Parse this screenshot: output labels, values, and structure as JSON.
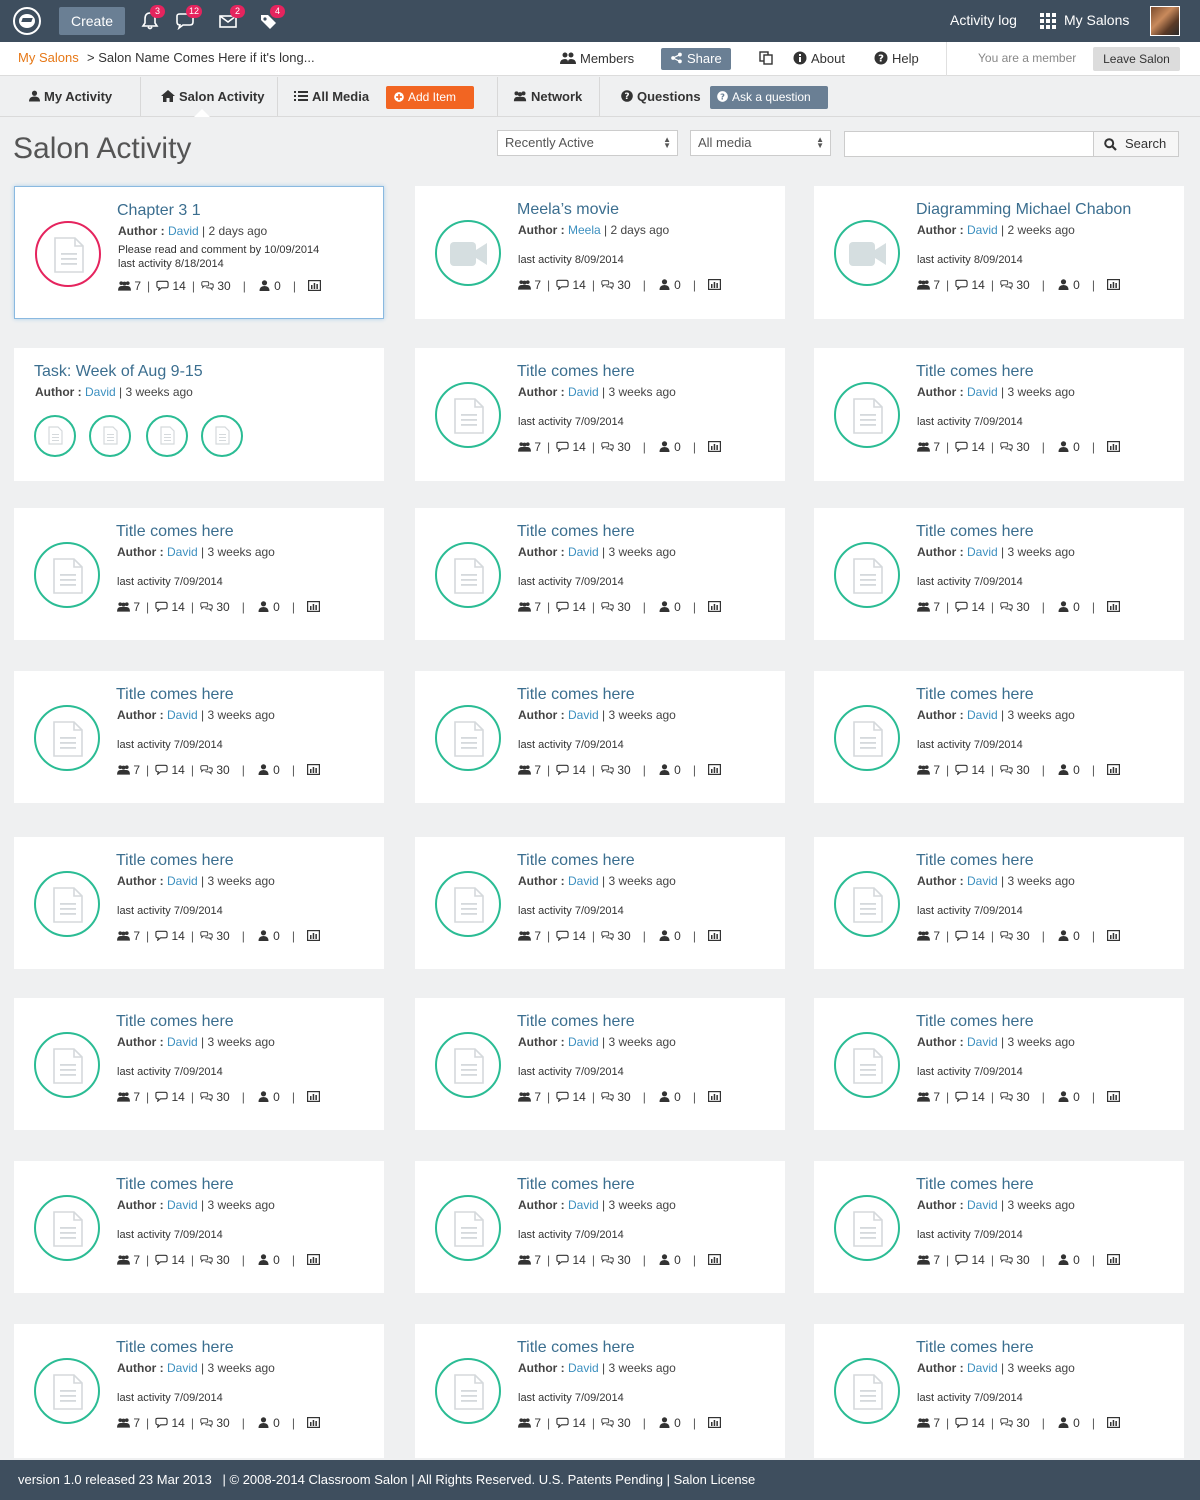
{
  "topbar": {
    "create_label": "Create",
    "badges": {
      "notifications": "3",
      "comments": "12",
      "messages": "2",
      "tags": "4"
    },
    "activity_log": "Activity log",
    "my_salons": "My Salons"
  },
  "subbar": {
    "crumb_root": "My Salons",
    "crumb_current": "> Salon Name Comes Here if it's long...",
    "members": "Members",
    "share": "Share",
    "about": "About",
    "help": "Help",
    "member_status": "You are a member",
    "leave": "Leave Salon"
  },
  "tabs": {
    "my_activity": "My Activity",
    "salon_activity": "Salon Activity",
    "all_media": "All Media",
    "add_item": "Add Item",
    "network": "Network",
    "questions": "Questions",
    "ask_question": "Ask a question"
  },
  "page": {
    "title": "Salon Activity",
    "sort_select": "Recently Active",
    "media_select": "All media",
    "search_button": "Search",
    "search_value": ""
  },
  "colors": {
    "accent_teal": "#2bbc94",
    "accent_pink": "#e5245e",
    "link": "#3b6e8f",
    "orange": "#f26522",
    "nav_bg": "#3e4e5e"
  },
  "cards": [
    {
      "title": "Chapter 3 1",
      "author_label": "Author :",
      "author": "David",
      "when": "| 2 days ago",
      "note": "Please read and comment by 10/09/2014",
      "last": "last activity 8/18/2014",
      "icon": "document-icon",
      "style": "pink",
      "stats": [
        "7",
        "14",
        "30",
        "0"
      ]
    },
    {
      "title": "Meela’s movie",
      "author_label": "Author :",
      "author": "Meela",
      "when": "| 2 days ago",
      "note": "",
      "last": "last activity 8/09/2014",
      "icon": "video-icon",
      "style": "video",
      "stats": [
        "7",
        "14",
        "30",
        "0"
      ]
    },
    {
      "title": "Diagramming Michael Chabon",
      "author_label": "Author :",
      "author": "David",
      "when": "| 2 weeks ago",
      "note": "",
      "last": "last activity 8/09/2014",
      "icon": "video-icon",
      "style": "video",
      "stats": [
        "7",
        "14",
        "30",
        "0"
      ]
    },
    {
      "title": "Task: Week of Aug 9-15",
      "author_label": "Author :",
      "author": "David",
      "when": "| 3 weeks ago",
      "task": true
    },
    {
      "title": "Title comes here",
      "author_label": "Author :",
      "author": "David",
      "when": "| 3 weeks ago",
      "note": "",
      "last": "last activity 7/09/2014",
      "icon": "document-icon",
      "style": "doc",
      "stats": [
        "7",
        "14",
        "30",
        "0"
      ]
    },
    {
      "title": "Title comes here",
      "author_label": "Author :",
      "author": "David",
      "when": "| 3 weeks ago",
      "note": "",
      "last": "last activity 7/09/2014",
      "icon": "document-icon",
      "style": "doc",
      "stats": [
        "7",
        "14",
        "30",
        "0"
      ]
    },
    {
      "title": "Title comes here",
      "author_label": "Author :",
      "author": "David",
      "when": "| 3 weeks ago",
      "note": "",
      "last": "last activity 7/09/2014",
      "icon": "document-icon",
      "style": "doc",
      "stats": [
        "7",
        "14",
        "30",
        "0"
      ]
    },
    {
      "title": "Title comes here",
      "author_label": "Author :",
      "author": "David",
      "when": "| 3 weeks ago",
      "note": "",
      "last": "last activity 7/09/2014",
      "icon": "document-icon",
      "style": "doc",
      "stats": [
        "7",
        "14",
        "30",
        "0"
      ]
    },
    {
      "title": "Title comes here",
      "author_label": "Author :",
      "author": "David",
      "when": "| 3 weeks ago",
      "note": "",
      "last": "last activity 7/09/2014",
      "icon": "document-icon",
      "style": "doc",
      "stats": [
        "7",
        "14",
        "30",
        "0"
      ]
    },
    {
      "title": "Title comes here",
      "author_label": "Author :",
      "author": "David",
      "when": "| 3 weeks ago",
      "note": "",
      "last": "last activity 7/09/2014",
      "icon": "document-icon",
      "style": "doc",
      "stats": [
        "7",
        "14",
        "30",
        "0"
      ]
    },
    {
      "title": "Title comes here",
      "author_label": "Author :",
      "author": "David",
      "when": "| 3 weeks ago",
      "note": "",
      "last": "last activity 7/09/2014",
      "icon": "document-icon",
      "style": "doc",
      "stats": [
        "7",
        "14",
        "30",
        "0"
      ]
    },
    {
      "title": "Title comes here",
      "author_label": "Author :",
      "author": "David",
      "when": "| 3 weeks ago",
      "note": "",
      "last": "last activity 7/09/2014",
      "icon": "document-icon",
      "style": "doc",
      "stats": [
        "7",
        "14",
        "30",
        "0"
      ]
    },
    {
      "title": "Title comes here",
      "author_label": "Author :",
      "author": "David",
      "when": "| 3 weeks ago",
      "note": "",
      "last": "last activity 7/09/2014",
      "icon": "document-icon",
      "style": "doc",
      "stats": [
        "7",
        "14",
        "30",
        "0"
      ]
    },
    {
      "title": "Title comes here",
      "author_label": "Author :",
      "author": "David",
      "when": "| 3 weeks ago",
      "note": "",
      "last": "last activity 7/09/2014",
      "icon": "document-icon",
      "style": "doc",
      "stats": [
        "7",
        "14",
        "30",
        "0"
      ]
    },
    {
      "title": "Title comes here",
      "author_label": "Author :",
      "author": "David",
      "when": "| 3 weeks ago",
      "note": "",
      "last": "last activity 7/09/2014",
      "icon": "document-icon",
      "style": "doc",
      "stats": [
        "7",
        "14",
        "30",
        "0"
      ]
    },
    {
      "title": "Title comes here",
      "author_label": "Author :",
      "author": "David",
      "when": "| 3 weeks ago",
      "note": "",
      "last": "last activity 7/09/2014",
      "icon": "document-icon",
      "style": "doc",
      "stats": [
        "7",
        "14",
        "30",
        "0"
      ]
    },
    {
      "title": "Title comes here",
      "author_label": "Author :",
      "author": "David",
      "when": "| 3 weeks ago",
      "note": "",
      "last": "last activity 7/09/2014",
      "icon": "document-icon",
      "style": "doc",
      "stats": [
        "7",
        "14",
        "30",
        "0"
      ]
    },
    {
      "title": "Title comes here",
      "author_label": "Author :",
      "author": "David",
      "when": "| 3 weeks ago",
      "note": "",
      "last": "last activity 7/09/2014",
      "icon": "document-icon",
      "style": "doc",
      "stats": [
        "7",
        "14",
        "30",
        "0"
      ]
    },
    {
      "title": "Title comes here",
      "author_label": "Author :",
      "author": "David",
      "when": "| 3 weeks ago",
      "note": "",
      "last": "last activity 7/09/2014",
      "icon": "document-icon",
      "style": "doc",
      "stats": [
        "7",
        "14",
        "30",
        "0"
      ]
    },
    {
      "title": "Title comes here",
      "author_label": "Author :",
      "author": "David",
      "when": "| 3 weeks ago",
      "note": "",
      "last": "last activity 7/09/2014",
      "icon": "document-icon",
      "style": "doc",
      "stats": [
        "7",
        "14",
        "30",
        "0"
      ]
    },
    {
      "title": "Title comes here",
      "author_label": "Author :",
      "author": "David",
      "when": "| 3 weeks ago",
      "note": "",
      "last": "last activity 7/09/2014",
      "icon": "document-icon",
      "style": "doc",
      "stats": [
        "7",
        "14",
        "30",
        "0"
      ]
    },
    {
      "title": "Title comes here",
      "author_label": "Author :",
      "author": "David",
      "when": "| 3 weeks ago",
      "note": "",
      "last": "last activity 7/09/2014",
      "icon": "document-icon",
      "style": "doc",
      "stats": [
        "7",
        "14",
        "30",
        "0"
      ]
    },
    {
      "title": "Title comes here",
      "author_label": "Author :",
      "author": "David",
      "when": "| 3 weeks ago",
      "note": "",
      "last": "last activity 7/09/2014",
      "icon": "document-icon",
      "style": "doc",
      "stats": [
        "7",
        "14",
        "30",
        "0"
      ]
    },
    {
      "title": "Title comes here",
      "author_label": "Author :",
      "author": "David",
      "when": "| 3 weeks ago",
      "note": "",
      "last": "last activity 7/09/2014",
      "icon": "document-icon",
      "style": "doc",
      "stats": [
        "7",
        "14",
        "30",
        "0"
      ]
    }
  ],
  "footer": {
    "text": "version 1.0 released 23 Mar 2013   | © 2008-2014 Classroom Salon | All Rights Reserved. U.S. Patents Pending | Salon License"
  }
}
